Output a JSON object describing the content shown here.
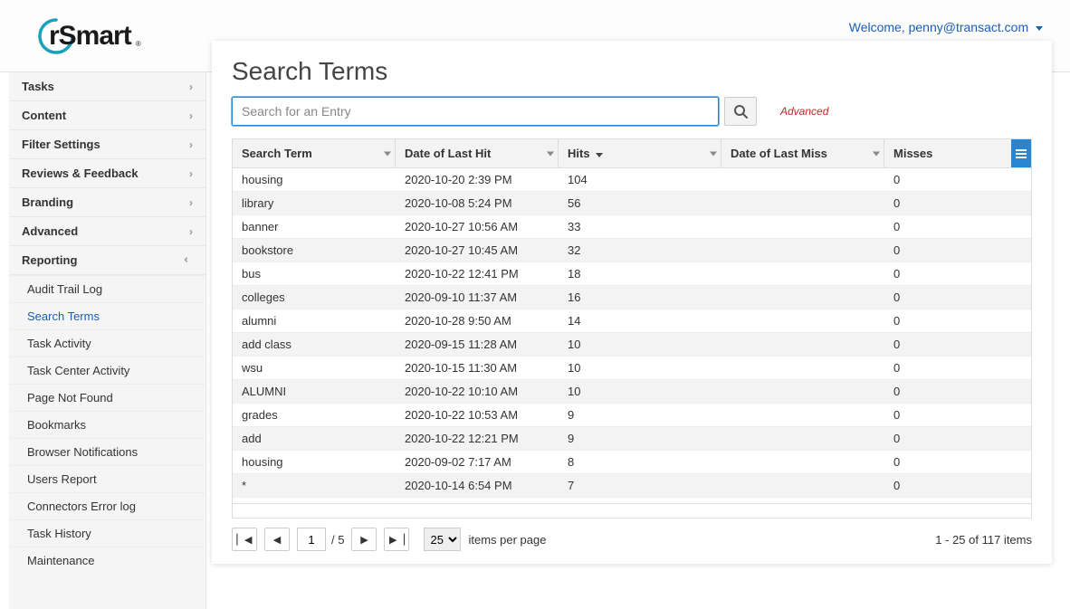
{
  "header": {
    "logo_text": "rSmart",
    "welcome_prefix": "Welcome, ",
    "user_email": "penny@transact.com"
  },
  "sidebar": {
    "groups": [
      {
        "label": "Tasks",
        "expanded": false
      },
      {
        "label": "Content",
        "expanded": false
      },
      {
        "label": "Filter Settings",
        "expanded": false
      },
      {
        "label": "Reviews & Feedback",
        "expanded": false
      },
      {
        "label": "Branding",
        "expanded": false
      },
      {
        "label": "Advanced",
        "expanded": false
      },
      {
        "label": "Reporting",
        "expanded": true,
        "items": [
          "Audit Trail Log",
          "Search Terms",
          "Task Activity",
          "Task Center Activity",
          "Page Not Found",
          "Bookmarks",
          "Browser Notifications",
          "Users Report",
          "Connectors Error log",
          "Task History",
          "Maintenance"
        ],
        "active_item": "Search Terms"
      }
    ]
  },
  "page": {
    "title": "Search Terms",
    "search_placeholder": "Search for an Entry",
    "advanced_link": "Advanced"
  },
  "grid": {
    "columns": [
      {
        "label": "Search Term"
      },
      {
        "label": "Date of Last Hit"
      },
      {
        "label": "Hits",
        "sort": "desc"
      },
      {
        "label": "Date of Last Miss"
      },
      {
        "label": "Misses"
      }
    ],
    "rows": [
      {
        "term": "housing",
        "last_hit": "2020-10-20 2:39 PM",
        "hits": "104",
        "last_miss": "",
        "misses": "0"
      },
      {
        "term": "library",
        "last_hit": "2020-10-08 5:24 PM",
        "hits": "56",
        "last_miss": "",
        "misses": "0"
      },
      {
        "term": "banner",
        "last_hit": "2020-10-27 10:56 AM",
        "hits": "33",
        "last_miss": "",
        "misses": "0"
      },
      {
        "term": "bookstore",
        "last_hit": "2020-10-27 10:45 AM",
        "hits": "32",
        "last_miss": "",
        "misses": "0"
      },
      {
        "term": "bus",
        "last_hit": "2020-10-22 12:41 PM",
        "hits": "18",
        "last_miss": "",
        "misses": "0"
      },
      {
        "term": "colleges",
        "last_hit": "2020-09-10 11:37 AM",
        "hits": "16",
        "last_miss": "",
        "misses": "0"
      },
      {
        "term": "alumni",
        "last_hit": "2020-10-28 9:50 AM",
        "hits": "14",
        "last_miss": "",
        "misses": "0"
      },
      {
        "term": "add class",
        "last_hit": "2020-09-15 11:28 AM",
        "hits": "10",
        "last_miss": "",
        "misses": "0"
      },
      {
        "term": "wsu",
        "last_hit": "2020-10-15 11:30 AM",
        "hits": "10",
        "last_miss": "",
        "misses": "0"
      },
      {
        "term": "ALUMNI",
        "last_hit": "2020-10-22 10:10 AM",
        "hits": "10",
        "last_miss": "",
        "misses": "0"
      },
      {
        "term": "grades",
        "last_hit": "2020-10-22 10:53 AM",
        "hits": "9",
        "last_miss": "",
        "misses": "0"
      },
      {
        "term": "add",
        "last_hit": "2020-10-22 12:21 PM",
        "hits": "9",
        "last_miss": "",
        "misses": "0"
      },
      {
        "term": "housing",
        "last_hit": "2020-09-02 7:17 AM",
        "hits": "8",
        "last_miss": "",
        "misses": "0"
      },
      {
        "term": "*",
        "last_hit": "2020-10-14 6:54 PM",
        "hits": "7",
        "last_miss": "",
        "misses": "0"
      }
    ]
  },
  "pager": {
    "page": "1",
    "total_pages": "5",
    "page_size": "25",
    "size_label": "items per page",
    "summary": "1 - 25 of 117 items",
    "of_sep": "/"
  }
}
